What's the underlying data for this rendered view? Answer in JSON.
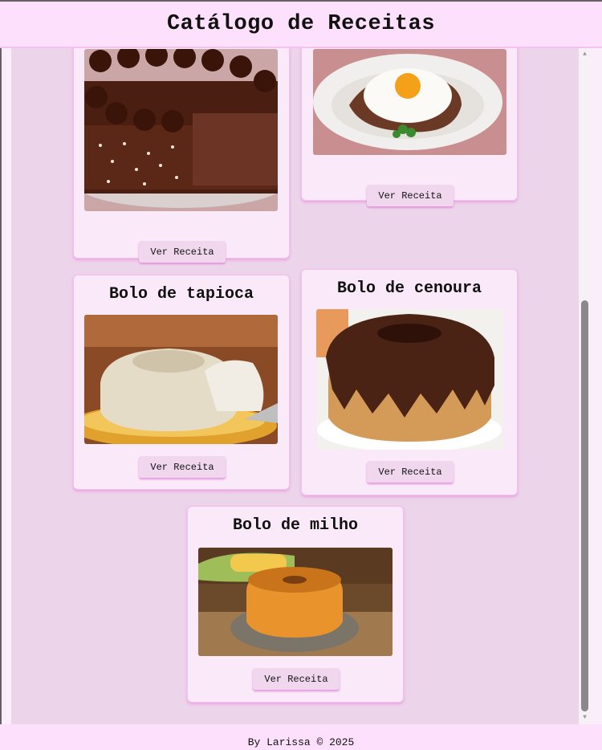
{
  "header": {
    "title": "Catálogo de Receitas"
  },
  "recipes": [
    {
      "title": "",
      "image": "chocolate-truffle-cake",
      "button": "Ver Receita"
    },
    {
      "title": "",
      "image": "steak-with-fried-egg",
      "button": "Ver Receita"
    },
    {
      "title": "Bolo de tapioca",
      "image": "tapioca-cake",
      "button": "Ver Receita"
    },
    {
      "title": "Bolo de cenoura",
      "image": "carrot-cake-chocolate-glaze",
      "button": "Ver Receita"
    },
    {
      "title": "Bolo de milho",
      "image": "corn-cake",
      "button": "Ver Receita"
    }
  ],
  "footer": {
    "text": "By Larissa © 2025"
  }
}
